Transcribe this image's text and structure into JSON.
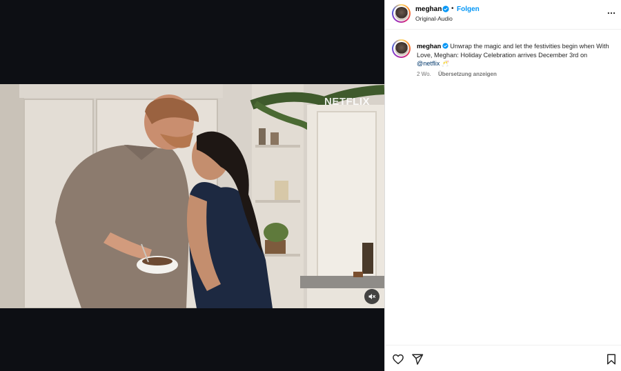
{
  "video": {
    "watermark": "NETFLIX"
  },
  "post": {
    "author": "meghan",
    "follow_label": "Folgen",
    "separator": "•",
    "audio": "Original-Audio",
    "caption": {
      "username": "meghan",
      "text": "Unwrap the magic and let the festivities begin when With Love, Meghan: Holiday Celebration arrives December 3rd on",
      "mention": "@netflix",
      "emoji": "🥂"
    },
    "age": "2 Wo.",
    "translate_label": "Übersetzung anzeigen"
  },
  "colors": {
    "accent": "#0095f6",
    "verified": "#0095f6",
    "mention": "#00376b",
    "video_background": "#0d0f14"
  },
  "icons": [
    "more-options-icon",
    "verified-badge-icon",
    "heart-icon",
    "share-icon",
    "bookmark-icon",
    "muted-speaker-icon"
  ]
}
